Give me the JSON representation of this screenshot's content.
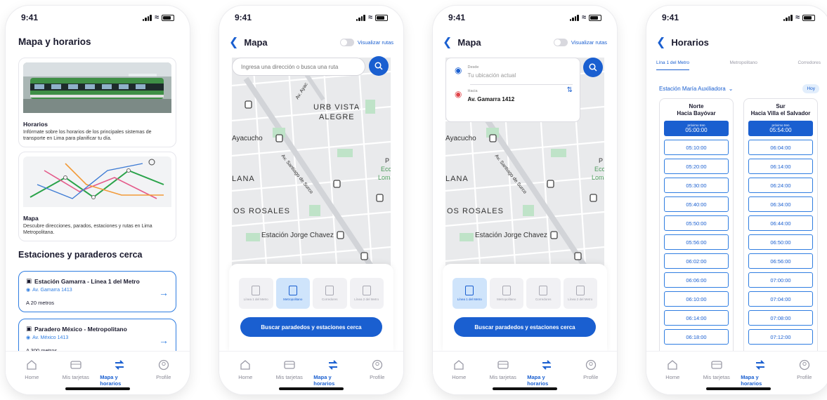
{
  "status": {
    "time": "9:41"
  },
  "nav": {
    "home": "Home",
    "cards": "Mis tarjetas",
    "map": "Mapa y horarios",
    "profile": "Profile"
  },
  "screen1": {
    "title": "Mapa y horarios",
    "horarios": {
      "title": "Horarios",
      "desc": "Infórmate sobre los horarios de los principales sistemas de transporte en Lima para planificar tu día."
    },
    "mapa": {
      "title": "Mapa",
      "desc": "Descubre direcciones, parados, estaciones y rutas en Lima Metropolitana."
    },
    "section": "Estaciones y paraderos cerca",
    "stops": [
      {
        "name": "Estación Gamarra - Línea 1 del Metro",
        "addr": "Av. Gamarra 1413",
        "dist": "A 20 metros"
      },
      {
        "name": "Paradero México - Metropolitano",
        "addr": "Av. México 1413",
        "dist": "A 300 metros"
      }
    ]
  },
  "map_screen": {
    "title": "Mapa",
    "toggle": "Visualizar rutas",
    "search_placeholder": "Ingresa una dirección o busca una ruta",
    "labels": [
      "URB VISTA",
      "ALEGRE",
      "Ayacucho",
      "LANA",
      "OS ROSALES",
      "Estación Jorge Chavez",
      "Av. Santiago de Surco",
      "Av. Ayac",
      "P",
      "Ecc",
      "Loma"
    ],
    "modes": [
      "Línea 1 del Metro",
      "Metropolitano",
      "Corredores",
      "Línea 2 del Metro"
    ],
    "cta": "Buscar paradedos y estaciones cerca"
  },
  "route": {
    "from_label": "Desde",
    "from_value": "Tu ubicación actual",
    "to_label": "Hacia",
    "to_value": "Av. Gamarra 1412"
  },
  "schedule": {
    "title": "Horarios",
    "tabs": [
      "Lína 1 del Metro",
      "Metropolitano",
      "Corredores"
    ],
    "station": "Estación María Auxiliadora",
    "today": "Hoy",
    "next_label": "próximo tren",
    "north": {
      "head1": "Norte",
      "head2": "Hacia Bayóvar",
      "next": "05:00:00",
      "times": [
        "05:10:00",
        "05:20:00",
        "05:30:00",
        "05:40:00",
        "05:50:00",
        "05:56:00",
        "06:02:00",
        "06:06:00",
        "06:10:00",
        "06:14:00",
        "06:18:00"
      ]
    },
    "south": {
      "head1": "Sur",
      "head2": "Hacia Villa el Salvador",
      "next": "05:54:00",
      "times": [
        "06:04:00",
        "06:14:00",
        "06:24:00",
        "06:34:00",
        "06:44:00",
        "06:50:00",
        "06:56:00",
        "07:00:00",
        "07:04:00",
        "07:08:00",
        "07:12:00"
      ]
    }
  },
  "colors": {
    "accent": "#1a5fd0",
    "link": "#2f7de1",
    "map_bg": "#e9eaec",
    "park": "#bfe3c8"
  }
}
